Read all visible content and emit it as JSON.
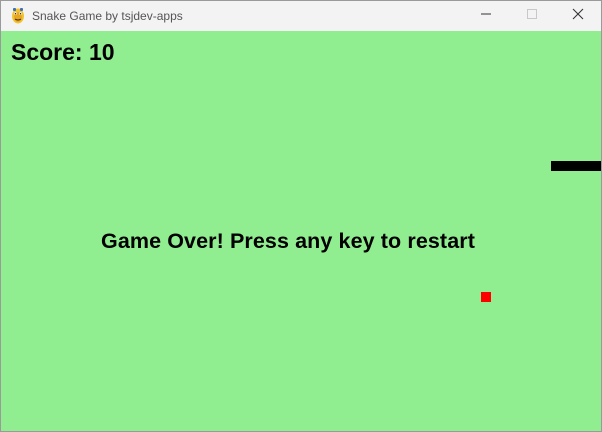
{
  "window": {
    "title": "Snake Game by tsjdev-apps",
    "icon": "python-icon",
    "controls": [
      "minimize-icon",
      "maximize-icon",
      "close-icon"
    ]
  },
  "game": {
    "score_text": "Score: 10",
    "message": "Game Over! Press any key to restart",
    "colors": {
      "background": "#90ee90",
      "snake": "#000000",
      "food": "#ff0000"
    }
  }
}
